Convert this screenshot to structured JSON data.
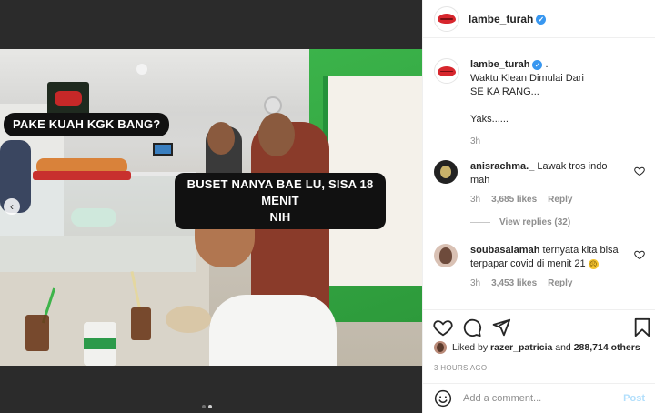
{
  "post": {
    "username": "lambe_turah",
    "verified": true,
    "caption": {
      "lines": [
        "Waktu Klean Dimulai Dari",
        "SE KA RANG...",
        "",
        "Yaks......"
      ],
      "time": "3h"
    }
  },
  "media": {
    "caption_top": "PAKE KUAH KGK BANG?",
    "caption_bottom_line1": "BUSET NANYA BAE LU, SISA 18 MENIT",
    "caption_bottom_line2": "NIH",
    "carousel_prev_icon": "chevron-left-icon",
    "dots": {
      "count": 2,
      "active_index": 1
    }
  },
  "comments": [
    {
      "username": "anisrachma._",
      "text": "Lawak tros indo mah",
      "time": "3h",
      "likes": "3,685 likes",
      "reply_label": "Reply",
      "view_replies": "View replies (32)"
    },
    {
      "username": "soubasalamah",
      "text": "ternyata kita bisa terpapar covid di menit 21",
      "emoji": "sad-face-emoji",
      "time": "3h",
      "likes": "3,453 likes",
      "reply_label": "Reply"
    }
  ],
  "likes": {
    "prefix": "Liked by",
    "user": "razer_patricia",
    "joiner": "and",
    "others": "288,714 others"
  },
  "time_ago": "3 HOURS AGO",
  "add_comment": {
    "placeholder": "Add a comment...",
    "post_label": "Post"
  },
  "colors": {
    "verified": "#3897f0",
    "post_disabled": "#b2dffc",
    "brand_red": "#d7262d"
  }
}
